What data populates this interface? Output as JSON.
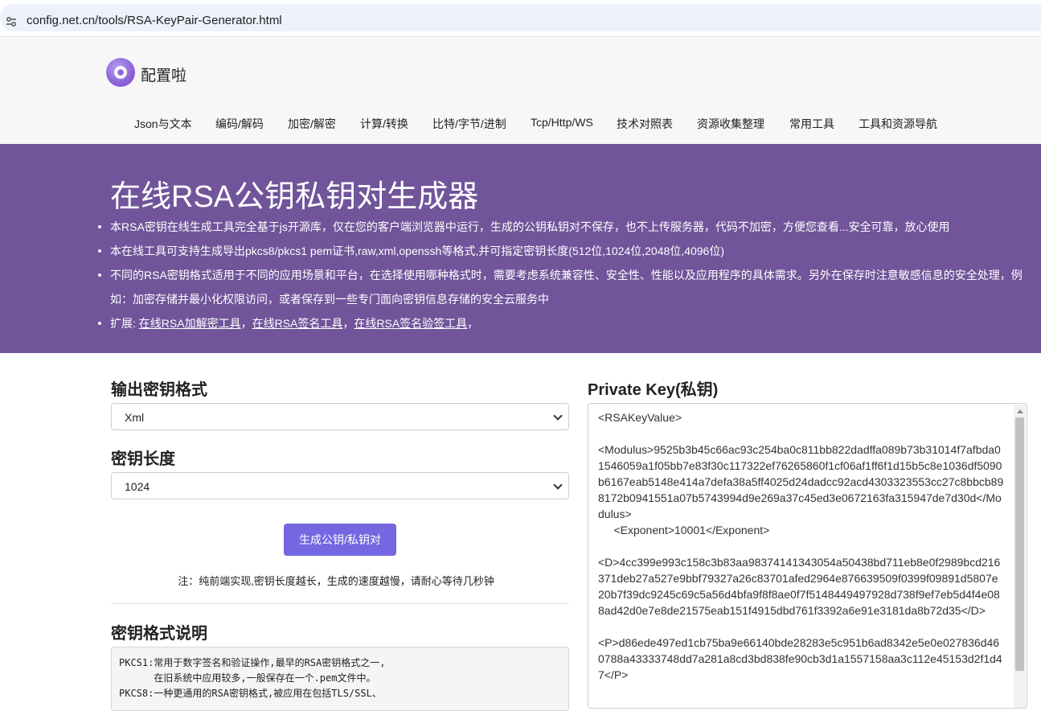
{
  "browser": {
    "url": "config.net.cn/tools/RSA-KeyPair-Generator.html",
    "site_icon": "tune-icon"
  },
  "site": {
    "brand": "配置啦",
    "nav": [
      "Json与文本",
      "编码/解码",
      "加密/解密",
      "计算/转换",
      "比特/字节/进制",
      "Tcp/Http/WS",
      "技术对照表",
      "资源收集整理",
      "常用工具",
      "工具和资源导航"
    ]
  },
  "hero": {
    "title": "在线RSA公钥私钥对生成器",
    "bullets": [
      "本RSA密钥在线生成工具完全基于js开源库，仅在您的客户端浏览器中运行，生成的公钥私钥对不保存，也不上传服务器，代码不加密，方便您查看...安全可靠，放心使用",
      "本在线工具可支持生成导出pkcs8/pkcs1 pem证书,raw,xml,openssh等格式,并可指定密钥长度(512位,1024位,2048位,4096位)",
      "不同的RSA密钥格式适用于不同的应用场景和平台，在选择使用哪种格式时，需要考虑系统兼容性、安全性、性能以及应用程序的具体需求。另外在保存时注意敏感信息的安全处理，例如：加密存储并最小化权限访问，或者保存到一些专门面向密钥信息存储的安全云服务中"
    ],
    "ext_label": "扩展: ",
    "ext_links": [
      "在线RSA加解密工具",
      "在线RSA签名工具",
      "在线RSA签名验签工具"
    ],
    "ext_sep": "，"
  },
  "form": {
    "format_title": "输出密钥格式",
    "format_value": "Xml",
    "length_title": "密钥长度",
    "length_value": "1024",
    "generate_label": "生成公钥/私钥对",
    "note": "注：纯前端实现,密钥长度越长，生成的速度越慢，请耐心等待几秒钟",
    "desc_title": "密钥格式说明",
    "desc_text": "PKCS1:常用于数字签名和验证操作,最早的RSA密钥格式之一,\n      在旧系统中应用较多,一般保存在一个.pem文件中。\nPKCS8:一种更通用的RSA密钥格式,被应用在包括TLS/SSL、"
  },
  "output": {
    "title": "Private Key(私钥)",
    "key_text": "<RSAKeyValue>\n\n<Modulus>9525b3b45c66ac93c254ba0c811bb822dadffa089b73b31014f7afbda01546059a1f05bb7e83f30c117322ef76265860f1cf06af1ff6f1d15b5c8e1036df5090b6167eab5148e414a7defa38a5ff4025d24dadcc92acd4303323553cc27c8bbcb898172b0941551a07b5743994d9e269a37c45ed3e0672163fa315947de7d30d</Modulus>\n     <Exponent>10001</Exponent>\n\n<D>4cc399e993c158c3b83aa98374141343054a50438bd711eb8e0f2989bcd216371deb27a527e9bbf79327a26c83701afed2964e876639509f0399f09891d5807e20b7f39dc9245c69c5a56d4bfa9f8f8ae0f7f5148449497928d738f9ef7eb5d4f4e088ad42d0e7e8de21575eab151f4915dbd761f3392a6e91e3181da8b72d35</D>\n\n<P>d86ede497ed1cb75ba9e66140bde28283e5c951b6ad8342e5e0e027836d460788a43333748dd7a281a8cd3bd838fe90cb3d1a1557158aa3c112e45153d2f1d47</P>"
  }
}
